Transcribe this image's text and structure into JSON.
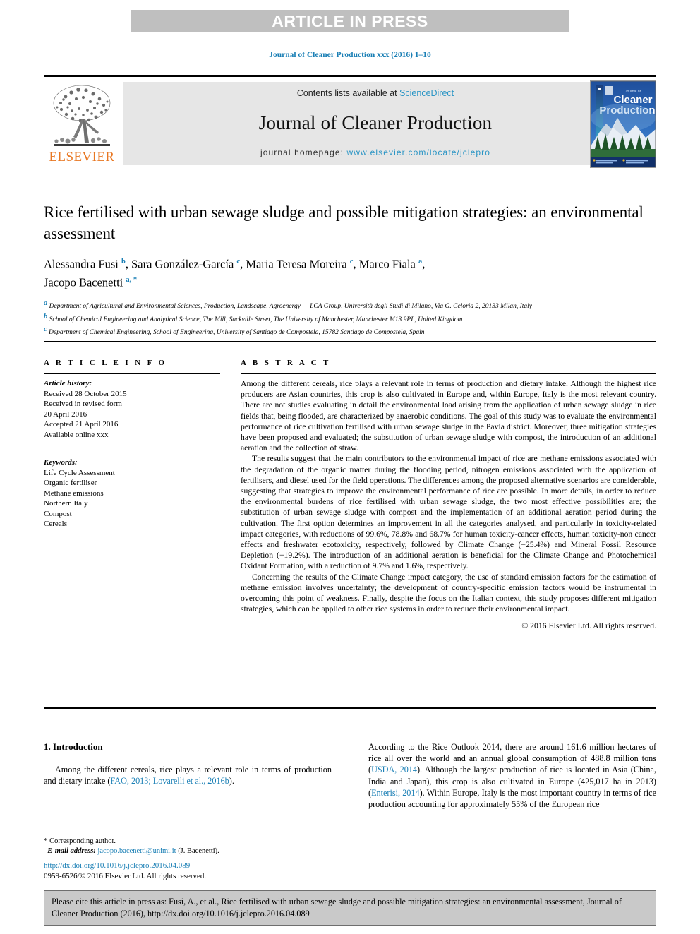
{
  "banner": {
    "label": "ARTICLE IN PRESS"
  },
  "journal_ref": "Journal of Cleaner Production xxx (2016) 1–10",
  "masthead": {
    "contents_prefix": "Contents lists available at ",
    "sciencedirect": "ScienceDirect",
    "journal_title": "Journal of Cleaner Production",
    "homepage_prefix": "journal homepage: ",
    "homepage_url": "www.elsevier.com/locate/jclepro",
    "publisher": "ELSEVIER",
    "cover_line1": "Journal of",
    "cover_line2": "Cleaner",
    "cover_line3": "Production"
  },
  "article": {
    "title": "Rice fertilised with urban sewage sludge and possible mitigation strategies: an environmental assessment",
    "authors_line1": "Alessandra Fusi ",
    "authors_sup1": "b",
    "authors_line2": ", Sara González-García ",
    "authors_sup2": "c",
    "authors_line3": ", Maria Teresa Moreira ",
    "authors_sup3": "c",
    "authors_line4": ", Marco Fiala ",
    "authors_sup4": "a",
    "authors_line5": ",",
    "authors_line6": "Jacopo Bacenetti ",
    "authors_sup5": "a, *",
    "affiliations": [
      {
        "marker": "a",
        "text": "Department of Agricultural and Environmental Sciences, Production, Landscape, Agroenergy — LCA Group, Università degli Studi di Milano, Via G. Celoria 2, 20133 Milan, Italy"
      },
      {
        "marker": "b",
        "text": "School of Chemical Engineering and Analytical Science, The Mill, Sackville Street, The University of Manchester, Manchester M13 9PL, United Kingdom"
      },
      {
        "marker": "c",
        "text": "Department of Chemical Engineering, School of Engineering, University of Santiago de Compostela, 15782 Santiago de Compostela, Spain"
      }
    ]
  },
  "article_info": {
    "heading": "A R T I C L E   I N F O",
    "history_label": "Article history:",
    "history": [
      "Received 28 October 2015",
      "Received in revised form",
      "20 April 2016",
      "Accepted 21 April 2016",
      "Available online xxx"
    ],
    "keywords_label": "Keywords:",
    "keywords": [
      "Life Cycle Assessment",
      "Organic fertiliser",
      "Methane emissions",
      "Northern Italy",
      "Compost",
      "Cereals"
    ]
  },
  "abstract": {
    "heading": "A B S T R A C T",
    "paragraphs": [
      "Among the different cereals, rice plays a relevant role in terms of production and dietary intake. Although the highest rice producers are Asian countries, this crop is also cultivated in Europe and, within Europe, Italy is the most relevant country. There are not studies evaluating in detail the environmental load arising from the application of urban sewage sludge in rice fields that, being flooded, are characterized by anaerobic conditions. The goal of this study was to evaluate the environmental performance of rice cultivation fertilised with urban sewage sludge in the Pavia district. Moreover, three mitigation strategies have been proposed and evaluated; the substitution of urban sewage sludge with compost, the introduction of an additional aeration and the collection of straw.",
      "The results suggest that the main contributors to the environmental impact of rice are methane emissions associated with the degradation of the organic matter during the flooding period, nitrogen emissions associated with the application of fertilisers, and diesel used for the field operations. The differences among the proposed alternative scenarios are considerable, suggesting that strategies to improve the environmental performance of rice are possible. In more details, in order to reduce the environmental burdens of rice fertilised with urban sewage sludge, the two most effective possibilities are; the substitution of urban sewage sludge with compost and the implementation of an additional aeration period during the cultivation. The first option determines an improvement in all the categories analysed, and particularly in toxicity-related impact categories, with reductions of 99.6%, 78.8% and 68.7% for human toxicity-cancer effects, human toxicity-non cancer effects and freshwater ecotoxicity, respectively, followed by Climate Change (−25.4%) and Mineral Fossil Resource Depletion (−19.2%). The introduction of an additional aeration is beneficial for the Climate Change and Photochemical Oxidant Formation, with a reduction of 9.7% and 1.6%, respectively.",
      "Concerning the results of the Climate Change impact category, the use of standard emission factors for the estimation of methane emission involves uncertainty; the development of country-specific emission factors would be instrumental in overcoming this point of weakness. Finally, despite the focus on the Italian context, this study proposes different mitigation strategies, which can be applied to other rice systems in order to reduce their environmental impact."
    ],
    "copyright": "© 2016 Elsevier Ltd. All rights reserved."
  },
  "body": {
    "section_heading": "1. Introduction",
    "left_para_part1": "Among the different cereals, rice plays a relevant role in terms of production and dietary intake (",
    "left_para_ref": "FAO, 2013; Lovarelli et al., 2016b",
    "left_para_part2": ").",
    "right_para": {
      "t1": "According to the Rice Outlook 2014, there are around 161.6 million hectares of rice all over the world and an annual global consumption of 488.8 million tons (",
      "r1": "USDA, 2014",
      "t2": "). Although the largest production of rice is located in Asia (China, India and Japan), this crop is also cultivated in Europe (425,017 ha in 2013) (",
      "r2": "Enterisi, 2014",
      "t3": "). Within Europe, Italy is the most important country in terms of rice production accounting for approximately 55% of the European rice"
    }
  },
  "footnote": {
    "star": "*",
    "corresponding": " Corresponding author.",
    "email_label": "E-mail address:",
    "email": " jacopo.bacenetti@unimi.it",
    "email_owner": " (J. Bacenetti)."
  },
  "doi": {
    "url": "http://dx.doi.org/10.1016/j.jclepro.2016.04.089",
    "issn_line": "0959-6526/© 2016 Elsevier Ltd. All rights reserved."
  },
  "cite_box": {
    "text": "Please cite this article in press as: Fusi, A., et al., Rice fertilised with urban sewage sludge and possible mitigation strategies: an environmental assessment, Journal of Cleaner Production (2016), http://dx.doi.org/10.1016/j.jclepro.2016.04.089"
  },
  "colors": {
    "link": "#1a7fb5",
    "sciencedirect": "#2a95c5",
    "elsevier_orange": "#E87722",
    "banner_gray": "#bfbfbf",
    "band_gray": "#e6e6e6",
    "cite_gray": "#c9c9c9"
  }
}
